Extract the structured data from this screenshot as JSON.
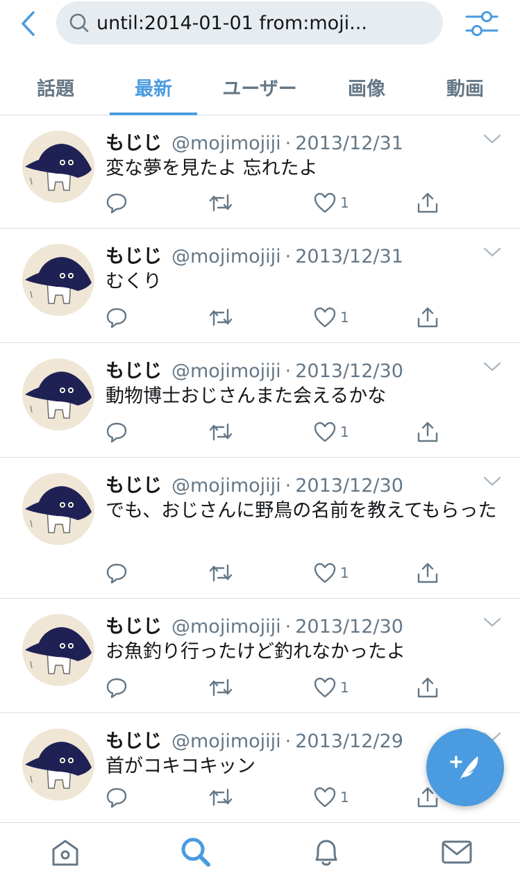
{
  "search": {
    "query": "until:2014-01-01 from:moji...",
    "back_icon": "chevron-left-icon",
    "filter_icon": "sliders-icon"
  },
  "tabs": [
    {
      "label": "話題",
      "active": false
    },
    {
      "label": "最新",
      "active": true
    },
    {
      "label": "ユーザー",
      "active": false
    },
    {
      "label": "画像",
      "active": false
    },
    {
      "label": "動画",
      "active": false
    }
  ],
  "tweets": [
    {
      "name": "もじじ",
      "handle": "@mojimojiji",
      "date": "2013/12/31",
      "text": "変な夢を見たよ 忘れたよ",
      "likes": "1"
    },
    {
      "name": "もじじ",
      "handle": "@mojimojiji",
      "date": "2013/12/31",
      "text": "むくり",
      "likes": "1"
    },
    {
      "name": "もじじ",
      "handle": "@mojimojiji",
      "date": "2013/12/30",
      "text": "動物博士おじさんまた会えるかな",
      "likes": "1"
    },
    {
      "name": "もじじ",
      "handle": "@mojimojiji",
      "date": "2013/12/30",
      "text": "でも、おじさんに野鳥の名前を教えてもらった",
      "likes": "1"
    },
    {
      "name": "もじじ",
      "handle": "@mojimojiji",
      "date": "2013/12/30",
      "text": "お魚釣り行ったけど釣れなかったよ",
      "likes": "1"
    },
    {
      "name": "もじじ",
      "handle": "@mojimojiji",
      "date": "2013/12/29",
      "text": "首がコキコキッン",
      "likes": "1"
    }
  ],
  "tweet_separator": "·",
  "colors": {
    "accent": "#4a9be0",
    "text_primary": "#14171a",
    "text_secondary": "#657786",
    "search_bg": "#e6ecf0",
    "avatar_bg": "#efe6d6",
    "avatar_hat": "#1f2154"
  },
  "bottom_nav": [
    "home-icon",
    "search-icon",
    "bell-icon",
    "mail-icon"
  ],
  "compose_icon": "compose-feather-icon"
}
